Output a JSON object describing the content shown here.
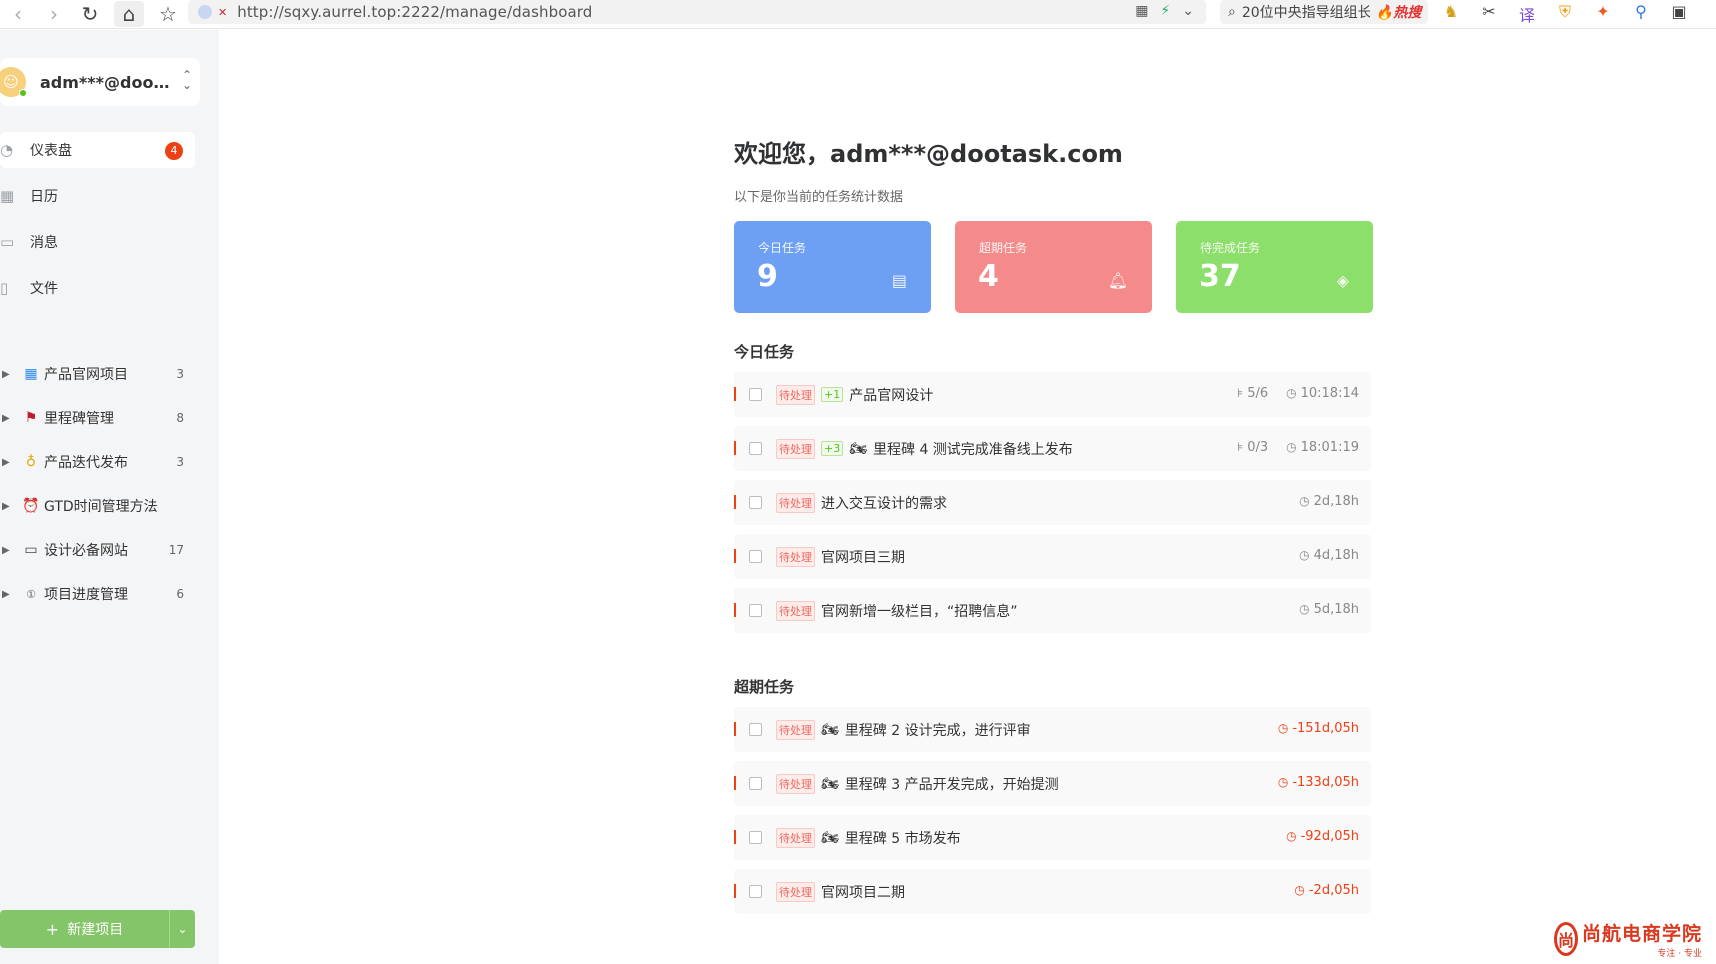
{
  "browser": {
    "url": "http://sqxy.aurrel.top:2222/manage/dashboard",
    "search_query": "20位中央指导组组长",
    "search_hot": "🔥热搜"
  },
  "sidebar": {
    "user_name": "adm***@doot...",
    "menu": [
      {
        "label": "仪表盘",
        "icon": "dashboard-icon",
        "badge": "4",
        "active": true
      },
      {
        "label": "日历",
        "icon": "calendar-icon"
      },
      {
        "label": "消息",
        "icon": "message-icon"
      },
      {
        "label": "文件",
        "icon": "file-icon"
      }
    ],
    "projects": [
      {
        "label": "产品官网项目",
        "count": "3",
        "icon": "grid-icon"
      },
      {
        "label": "里程碑管理",
        "count": "8",
        "icon": "flag-icon"
      },
      {
        "label": "产品迭代发布",
        "count": "3",
        "icon": "bulb-icon"
      },
      {
        "label": "GTD时间管理方法",
        "count": "",
        "icon": "alarm-clock-icon"
      },
      {
        "label": "设计必备网站",
        "count": "17",
        "icon": "monitor-icon"
      },
      {
        "label": "项目进度管理",
        "count": "6",
        "icon": "number-one-icon"
      }
    ],
    "new_project_label": "新建项目"
  },
  "main": {
    "welcome": "欢迎您，adm***@dootask.com",
    "subtitle": "以下是你当前的任务统计数据",
    "cards": [
      {
        "label": "今日任务",
        "value": "9",
        "color": "#6d9ff3",
        "icon": "list-icon"
      },
      {
        "label": "超期任务",
        "value": "4",
        "color": "#f58a8a",
        "icon": "bell-icon"
      },
      {
        "label": "待完成任务",
        "value": "37",
        "color": "#8ddf6b",
        "icon": "layers-icon"
      }
    ],
    "today_title": "今日任务",
    "today_tasks": [
      {
        "status": "待处理",
        "sub": "+1",
        "name": "产品官网设计",
        "subtasks": "5/6",
        "time": "10:18:14"
      },
      {
        "status": "待处理",
        "sub": "+3",
        "icon": "🏍",
        "name": "里程碑 4 测试完成准备线上发布",
        "subtasks": "0/3",
        "time": "18:01:19"
      },
      {
        "status": "待处理",
        "name": "进入交互设计的需求",
        "time": "2d,18h"
      },
      {
        "status": "待处理",
        "name": "官网项目三期",
        "time": "4d,18h"
      },
      {
        "status": "待处理",
        "name": "官网新增一级栏目，“招聘信息”",
        "time": "5d,18h"
      }
    ],
    "overdue_title": "超期任务",
    "overdue_tasks": [
      {
        "status": "待处理",
        "icon": "🏍",
        "name": "里程碑 2 设计完成，进行评审",
        "time": "-151d,05h"
      },
      {
        "status": "待处理",
        "icon": "🏍",
        "name": "里程碑 3 产品开发完成，开始提测",
        "time": "-133d,05h"
      },
      {
        "status": "待处理",
        "icon": "🏍",
        "name": "里程碑 5 市场发布",
        "time": "-92d,05h"
      },
      {
        "status": "待处理",
        "name": "官网项目二期",
        "time": "-2d,05h"
      }
    ]
  },
  "watermark": {
    "title": "尚航电商学院",
    "tagline": "专注 · 专业"
  }
}
